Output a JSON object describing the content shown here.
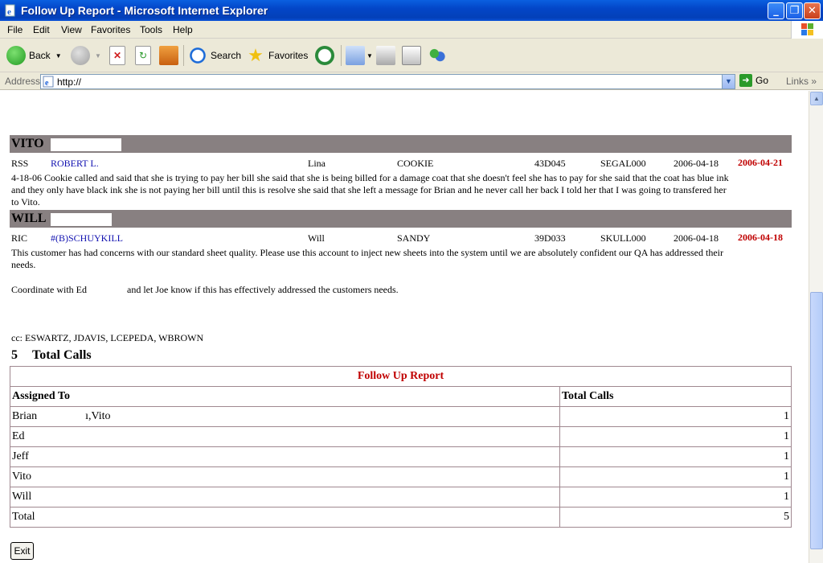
{
  "window": {
    "title": "Follow Up Report - Microsoft Internet Explorer",
    "minimize": "_",
    "maximize": "❐",
    "close": "✕"
  },
  "menu": [
    "File",
    "Edit",
    "View",
    "Favorites",
    "Tools",
    "Help"
  ],
  "toolbar": {
    "back": "Back",
    "search": "Search",
    "favorites": "Favorites"
  },
  "address": {
    "label": "Address",
    "value": "http://",
    "go": "Go",
    "links": "Links"
  },
  "groups": [
    {
      "name": "VITO",
      "row": {
        "code": "RSS",
        "customer": "ROBERT L.",
        "contact": "Lina",
        "account": "COOKIE",
        "id": "43D045",
        "ref": "SEGAL000",
        "date": "2006-04-18",
        "followup": "2006-04-21"
      },
      "notes": "4-18-06 Cookie called and said that she is trying to pay her bill she said that she is being billed for a damage coat that she doesn't feel she has to pay for she said that the coat has blue ink and they only have black ink she is not paying her bill until this is resolve she said that she left a message for Brian and he never call her back I told her that I was going to transfered her to Vito."
    },
    {
      "name": "WILL",
      "row": {
        "code": "RIC",
        "customer": "#(B)SCHUYKILL",
        "contact": "Will",
        "account": "SANDY",
        "id": "39D033",
        "ref": "SKULL000",
        "date": "2006-04-18",
        "followup": "2006-04-18"
      },
      "notes": "This customer has had concerns with our standard sheet quality. Please use this account to inject new sheets into the system until we are absolutely confident our QA has addressed their needs.",
      "notes2_a": "Coordinate with Ed",
      "notes2_b": "and let Joe know if this has effectively addressed the customers needs.",
      "cc": "cc: ESWARTZ, JDAVIS, LCEPEDA, WBROWN"
    }
  ],
  "total_calls": {
    "count": "5",
    "label": "Total Calls"
  },
  "report": {
    "caption": "Follow Up Report",
    "col_assigned": "Assigned To",
    "col_total": "Total Calls",
    "rows": [
      {
        "name_a": "Brian",
        "name_b": "ı,Vito",
        "calls": "1"
      },
      {
        "name_a": "Ed",
        "calls": "1"
      },
      {
        "name_a": "Jeff",
        "calls": "1"
      },
      {
        "name_a": "Vito",
        "calls": "1"
      },
      {
        "name_a": "Will",
        "calls": "1"
      }
    ],
    "total_label": "Total",
    "total_value": "5"
  },
  "exit": "Exit",
  "colors": {
    "group_header": "#888081",
    "accent_red": "#c00000",
    "link_blue": "#1010b0",
    "xp_title": "#0346c8"
  }
}
